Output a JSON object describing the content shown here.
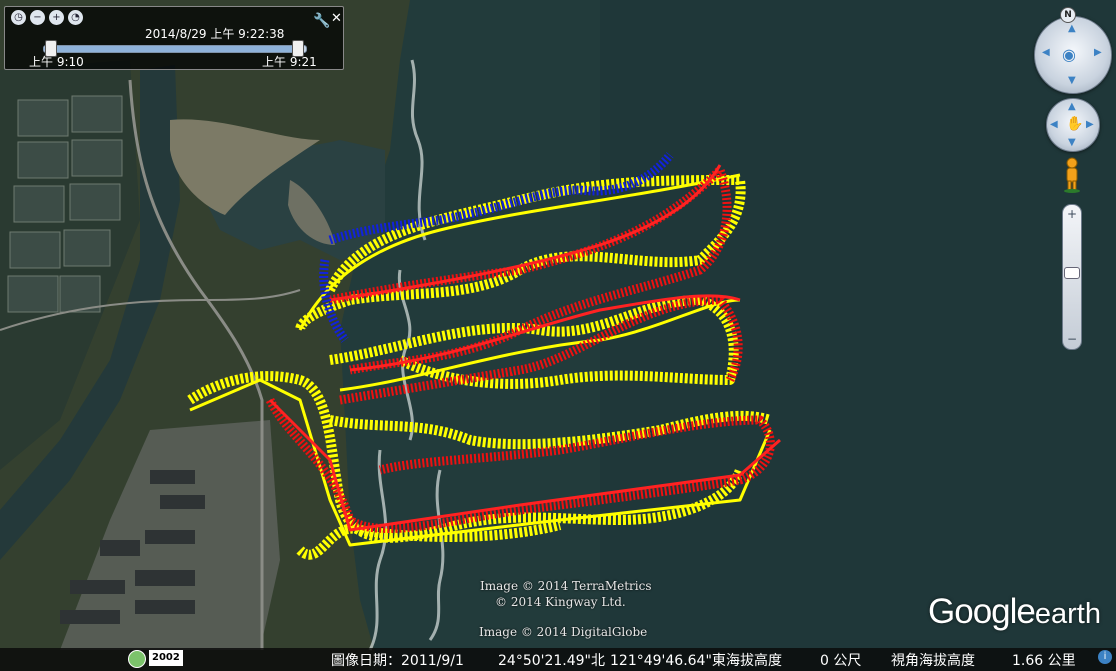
{
  "time_slider": {
    "current_time": "2014/8/29 上午   9:22:38",
    "start_label": "上午   9:10",
    "end_label": "上午   9:21",
    "position_fraction": 0.97
  },
  "credits": {
    "line1": "Image © 2014 TerraMetrics",
    "line2": "© 2014 Kingway Ltd.",
    "line3": "Image © 2014 DigitalGlobe"
  },
  "logo": {
    "google": "Google",
    "earth": "earth"
  },
  "status_bar": {
    "year_badge": "2002",
    "imagery_date": "圖像日期：2011/9/1",
    "latitude": "24°50'21.49\"北",
    "longitude": "121°49'46.64\"東",
    "elevation_label": "海拔高度",
    "elevation_value": "0 公尺",
    "eye_alt_label": "視角海拔高度",
    "eye_alt_value": "1.66 公里"
  },
  "nav": {
    "north_label": "N",
    "zoom_in": "+",
    "zoom_out": "−"
  },
  "tracks": {
    "colors": [
      "#ffff00",
      "#ee1111",
      "#1122dd"
    ]
  },
  "icons": {
    "time_back": "clock-back-icon",
    "zoom_out_time": "zoom-out-icon",
    "zoom_in_time": "zoom-in-icon",
    "clock": "clock-icon",
    "wrench": "wrench-icon",
    "close": "close-icon",
    "pegman": "pegman-icon",
    "tour": "tour-icon",
    "info": "info-icon"
  }
}
